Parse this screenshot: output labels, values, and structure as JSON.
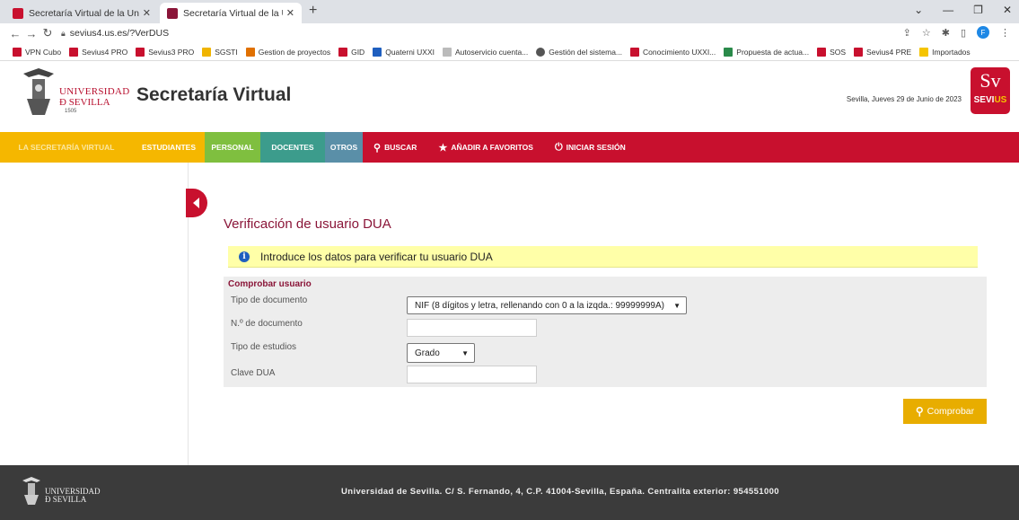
{
  "browser": {
    "tabs": [
      {
        "title": "Secretaría Virtual de la Universid",
        "active": false,
        "icon": "us-icon"
      },
      {
        "title": "Secretaría Virtual de la Universid",
        "active": true,
        "icon": "sv-icon"
      }
    ],
    "url": "sevius4.us.es/?VerDUS",
    "bookmarks": [
      {
        "label": "VPN Cubo",
        "color": "#c8102e"
      },
      {
        "label": "Sevius4 PRO",
        "color": "#c8102e"
      },
      {
        "label": "Sevius3 PRO",
        "color": "#c8102e"
      },
      {
        "label": "SGSTI",
        "color": "#f0b400"
      },
      {
        "label": "Gestion de proyectos",
        "color": "#e07000"
      },
      {
        "label": "GID",
        "color": "#c8102e"
      },
      {
        "label": "Quaterni UXXI",
        "color": "#1f5fbf"
      },
      {
        "label": "Autoservicio cuenta...",
        "color": "#bbbbbb"
      },
      {
        "label": "Gestión del sistema...",
        "color": "#555555"
      },
      {
        "label": "Conocimiento UXXI...",
        "color": "#c8102e"
      },
      {
        "label": "Propuesta de actua...",
        "color": "#2a8a4a"
      },
      {
        "label": "SOS",
        "color": "#c8102e"
      },
      {
        "label": "Sevius4 PRE",
        "color": "#c8102e"
      },
      {
        "label": "Importados",
        "color": "#f5c400"
      }
    ]
  },
  "header": {
    "logo_line1": "UNIVERSIDAD",
    "logo_line2": "Ð SEVILLA",
    "logo_year": "1505",
    "title": "Secretaría Virtual",
    "date": "Sevilla, Jueves 29 de Junio de 2023",
    "sevius_mark": "Sv",
    "sevius_sub_a": "SEVI",
    "sevius_sub_b": "US"
  },
  "nav": {
    "items": [
      "LA SECRETARÍA VIRTUAL",
      "ESTUDIANTES",
      "PERSONAL",
      "DOCENTES",
      "OTROS",
      "BUSCAR",
      "AÑADIR A FAVORITOS",
      "INICIAR SESIÓN"
    ]
  },
  "main": {
    "heading": "Verificación de usuario DUA",
    "info": "Introduce los datos para verificar tu usuario DUA",
    "form": {
      "legend": "Comprobar usuario",
      "doc_type_label": "Tipo de documento",
      "doc_type_value": "NIF (8 dígitos y letra, rellenando con 0 a la izqda.: 99999999A)",
      "doc_number_label": "N.º de documento",
      "doc_number_value": "",
      "study_type_label": "Tipo de estudios",
      "study_type_value": "Grado",
      "dua_key_label": "Clave DUA",
      "dua_key_value": ""
    },
    "submit_label": "Comprobar"
  },
  "footer": {
    "logo_line1": "UNIVERSIDAD",
    "logo_line2": "Ð SEVILLA",
    "address": "Universidad de Sevilla. C/ S. Fernando, 4, C.P. 41004-Sevilla, España. Centralita exterior: 954551000"
  }
}
